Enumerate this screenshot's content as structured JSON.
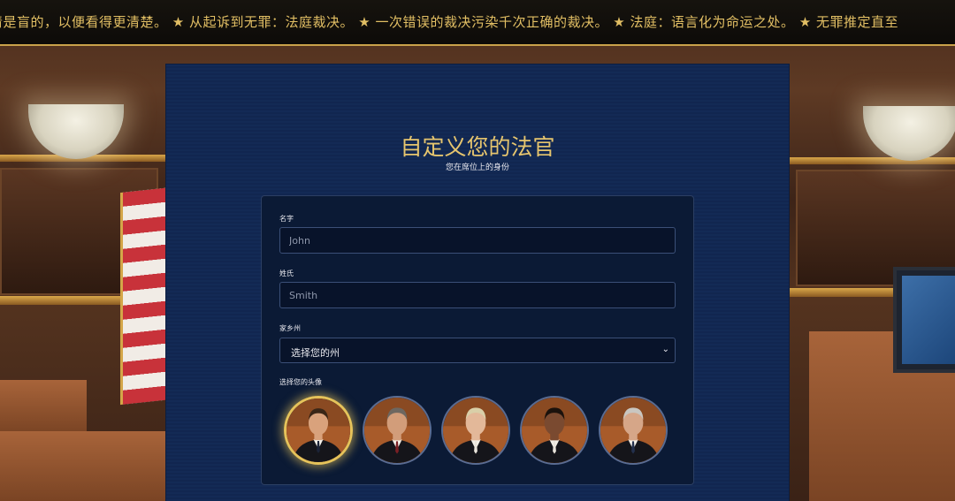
{
  "ticker": {
    "text": "清是盲的，以便看得更清楚。 ★ 从起诉到无罪：法庭裁决。 ★ 一次错误的裁决污染千次正确的裁决。 ★ 法庭：语言化为命运之处。 ★ 无罪推定直至"
  },
  "page": {
    "title": "自定义您的法官",
    "subtitle": "您在席位上的身份"
  },
  "form": {
    "first_name": {
      "label": "名字",
      "placeholder": "John"
    },
    "last_name": {
      "label": "姓氏",
      "placeholder": "Smith"
    },
    "home_state": {
      "label": "家乡州",
      "selected": "选择您的州"
    },
    "avatar": {
      "label": "选择您的头像",
      "options": [
        {
          "name": "avatar-1",
          "selected": true,
          "skin": "#d9a27c",
          "hair": "#3a2617",
          "tie": "#1b2338"
        },
        {
          "name": "avatar-2",
          "selected": false,
          "skin": "#d29d7a",
          "hair": "#6d6760",
          "tie": "#7a1f24"
        },
        {
          "name": "avatar-3",
          "selected": false,
          "skin": "#e3b899",
          "hair": "#d9cfa8",
          "tie": "#e9e4dc"
        },
        {
          "name": "avatar-4",
          "selected": false,
          "skin": "#7a4a30",
          "hair": "#1b120c",
          "tie": "#e9e4dc"
        },
        {
          "name": "avatar-5",
          "selected": false,
          "skin": "#d6a688",
          "hair": "#c9c6c0",
          "tie": "#23304d"
        }
      ]
    }
  },
  "colors": {
    "accent_gold": "#e6c56e",
    "card_bg": "#132a55",
    "form_bg": "#0b1a35"
  }
}
